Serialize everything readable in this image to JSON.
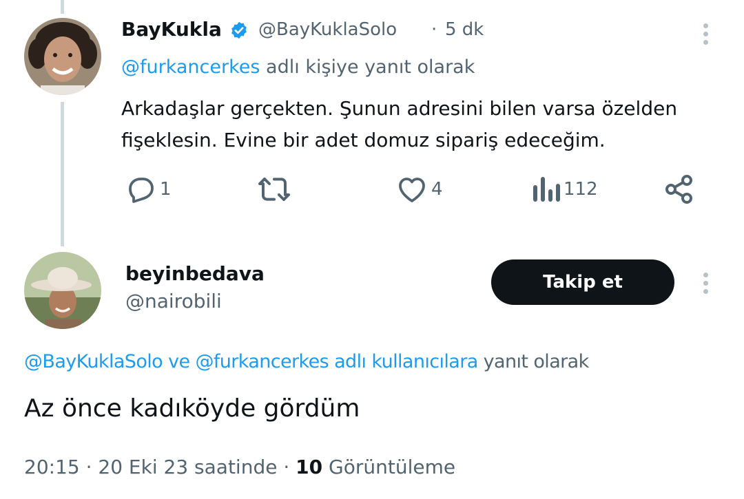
{
  "colors": {
    "accent": "#1d9bf0",
    "verified": "#1d9bf0",
    "text": "#0f1419",
    "muted": "#536471",
    "button_bg": "#0f1419"
  },
  "parent_tweet": {
    "display_name": "BayKukla",
    "handle": "@BayKuklaSolo",
    "separator": "·",
    "time_ago": "5 dk",
    "reply_mention": "@furkancerkes",
    "reply_suffix": "adlı kişiye yanıt olarak",
    "text_line1": "Arkadaşlar gerçekten. Şunun adresini bilen varsa özelden",
    "text_line2": "fişeklesin. Evine bir adet domuz sipariş edeceğim.",
    "actions": {
      "replies": "1",
      "likes": "4",
      "views": "112"
    },
    "icons": [
      "reply-icon",
      "retweet-icon",
      "like-icon",
      "views-icon",
      "share-icon",
      "verified-badge-icon",
      "more-icon"
    ]
  },
  "reply_tweet": {
    "display_name": "beyinbedava",
    "handle": "@nairobili",
    "follow_label": "Takip et",
    "reply_mention_1": "@BayKuklaSolo",
    "reply_joiner": "ve",
    "reply_mention_2": "@furkancerkes",
    "reply_tail_linked": "adlı kullanıcılara",
    "reply_tail_plain": "yanıt olarak",
    "text": "Az önce kadıköyde gördüm",
    "timestamp": "20:15 · 20 Eki 23 saatinde",
    "meta_separator": "·",
    "view_count": "10",
    "view_label": "Görüntüleme"
  }
}
